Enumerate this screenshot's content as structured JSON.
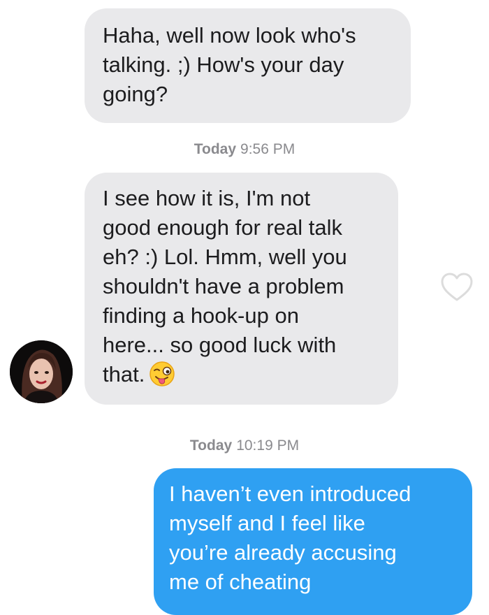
{
  "messages": [
    {
      "direction": "incoming",
      "lines": [
        "Haha, well now look who's",
        "talking. ;) How's your day",
        "going?"
      ]
    },
    {
      "direction": "incoming",
      "lines": [
        "I see how it is, I'm not",
        "good enough for real talk",
        "eh? :) Lol. Hmm, well you",
        "shouldn't have a problem",
        "finding a hook-up on",
        "here... so good luck with",
        "that."
      ],
      "emoji": "winking-face-with-tongue"
    },
    {
      "direction": "outgoing",
      "lines": [
        "I haven’t even introduced",
        "myself and I feel like",
        "you’re already accusing",
        "me of cheating"
      ]
    }
  ],
  "timestamps": [
    {
      "day": "Today",
      "time": "9:56 PM"
    },
    {
      "day": "Today",
      "time": "10:19 PM"
    }
  ],
  "icons": {
    "like": "heart-outline-icon",
    "avatar": "contact-avatar"
  },
  "colors": {
    "incoming_bubble": "#e9e9eb",
    "outgoing_bubble": "#2fa0f2",
    "timestamp_text": "#8a8a8e",
    "background": "#ffffff"
  }
}
